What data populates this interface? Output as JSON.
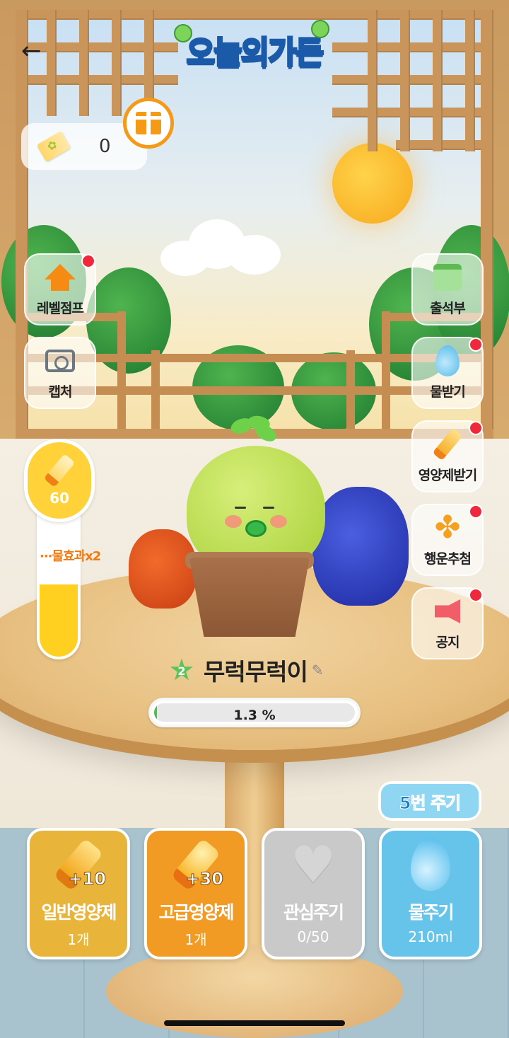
{
  "header": {
    "back_icon": "arrow-left-icon",
    "logo_text": "오늘의가든"
  },
  "tickets": {
    "count": "0",
    "icon": "ticket-icon",
    "gift_icon": "gift-icon"
  },
  "left_buttons": [
    {
      "label": "레벨점프",
      "icon": "level-up-arrow-icon",
      "badge": true
    },
    {
      "label": "캡처",
      "icon": "camera-icon",
      "badge": false
    }
  ],
  "right_buttons": [
    {
      "label": "출석부",
      "icon": "calendar-icon",
      "badge": false
    },
    {
      "label": "물받기",
      "icon": "water-drop-icon",
      "badge": true
    },
    {
      "label": "영양제받기",
      "icon": "nutrient-bottle-icon",
      "badge": true
    },
    {
      "label": "행운추첨",
      "icon": "clover-icon",
      "badge": true
    },
    {
      "label": "공지",
      "icon": "megaphone-icon",
      "badge": true
    }
  ],
  "gauge": {
    "value": "60",
    "fill_fraction": 0.5,
    "marker_label": "물효과x2",
    "color": "#ffd01f"
  },
  "plant": {
    "level": "2",
    "name": "무럭무럭이",
    "progress_text": "1.3 %",
    "progress_fraction": 0.013
  },
  "water_times_badge": "5번 주기",
  "actions": [
    {
      "title": "일반영양제",
      "sub": "1개",
      "plus": "+10",
      "icon": "nutrient-bottle-icon",
      "bg": "#e9b43a"
    },
    {
      "title": "고급영양제",
      "sub": "1개",
      "plus": "+30",
      "icon": "premium-nutrient-bottle-icon",
      "bg": "#f19a24"
    },
    {
      "title": "관심주기",
      "sub": "0/50",
      "plus": "",
      "icon": "heart-icon",
      "bg": "#c9c9c9"
    },
    {
      "title": "물주기",
      "sub": "210ml",
      "plus": "",
      "icon": "water-drop-icon",
      "bg": "#66c3ea"
    }
  ],
  "colors": {
    "accent_orange": "#f59a17",
    "badge_red": "#f0283b",
    "progress_green": "#47c24a",
    "water_blue": "#66c3ea"
  }
}
